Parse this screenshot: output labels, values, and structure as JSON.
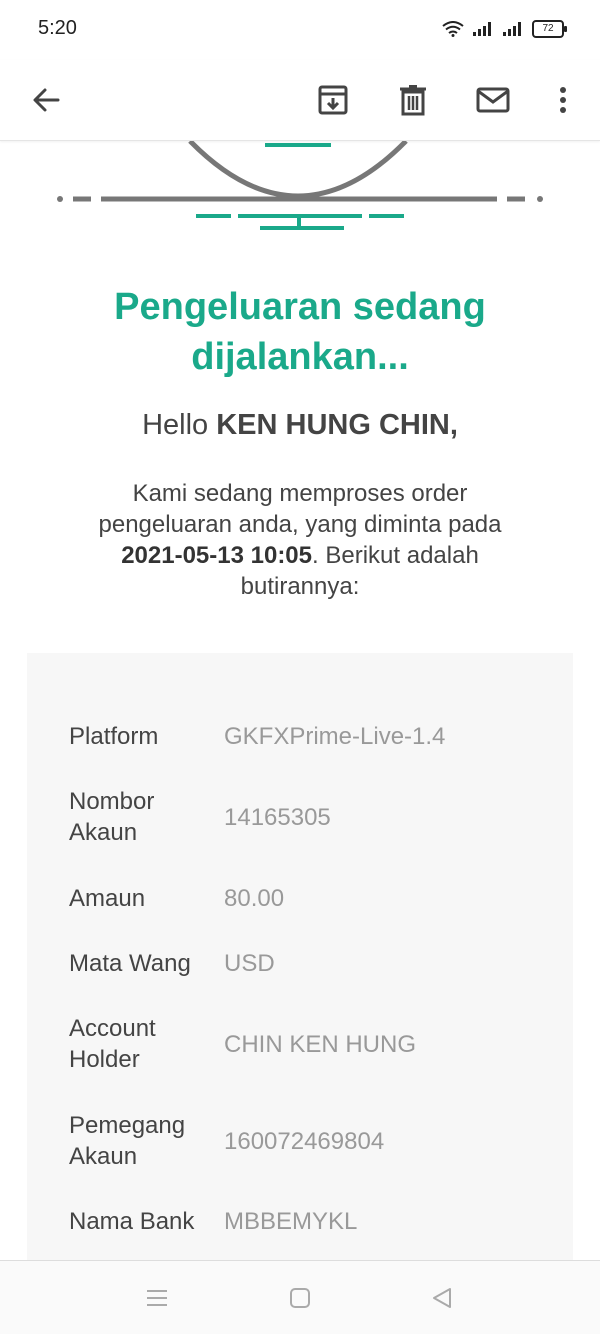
{
  "status_bar": {
    "time": "5:20",
    "battery": "72"
  },
  "toolbar": {
    "back": "back-arrow-icon",
    "archive": "archive-icon",
    "delete": "trash-icon",
    "mark_unread": "mail-icon",
    "more": "more-vertical-icon"
  },
  "email": {
    "headline_line1": "Pengeluaran sedang",
    "headline_line2": "dijalankan...",
    "greeting_prefix": "Hello ",
    "greeting_name": "KEN HUNG CHIN,",
    "message_part1": "Kami sedang memproses order pengeluaran anda, yang diminta pada ",
    "message_date": "2021-05-13 10:05",
    "message_part2": ". Berikut adalah butirannya:",
    "accent_color": "#1aa98a"
  },
  "details": [
    {
      "label": "Platform",
      "value": "GKFXPrime-Live-1.4"
    },
    {
      "label": "Nombor Akaun",
      "value": "14165305"
    },
    {
      "label": "Amaun",
      "value": "80.00"
    },
    {
      "label": "Mata Wang",
      "value": "USD"
    },
    {
      "label": "Account Holder",
      "value": "CHIN KEN HUNG"
    },
    {
      "label": "Pemegang Akaun",
      "value": "160072469804"
    },
    {
      "label": "Nama Bank",
      "value": "MBBEMYKL"
    }
  ],
  "navbar": {
    "menu": "menu-icon",
    "home": "home-square-icon",
    "back": "back-triangle-icon"
  }
}
